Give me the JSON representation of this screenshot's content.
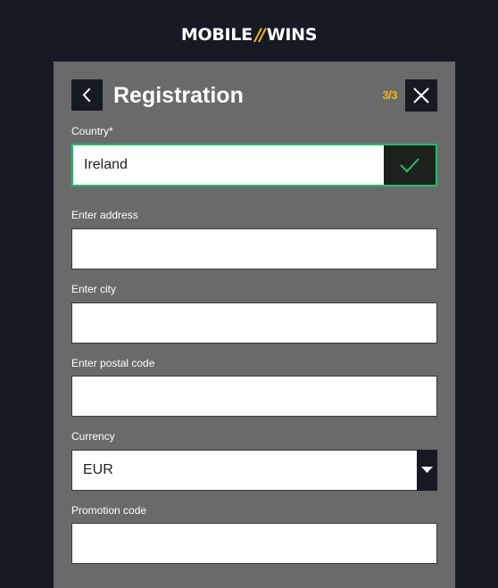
{
  "logo": {
    "left": "MOBILE",
    "slash": "//",
    "right": "WINS",
    "brand_accent_color": "#f5b800"
  },
  "header": {
    "title": "Registration",
    "step": "3/3",
    "back_icon": "chevron-left-icon",
    "close_icon": "close-icon"
  },
  "form": {
    "country": {
      "label": "Country*",
      "value": "Ireland",
      "status": "valid",
      "status_icon": "checkmark-icon",
      "valid_color": "#1fbf6a"
    },
    "address": {
      "label": "Enter address",
      "value": ""
    },
    "city": {
      "label": "Enter city",
      "value": ""
    },
    "postal_code": {
      "label": "Enter postal code",
      "value": ""
    },
    "currency": {
      "label": "Currency",
      "value": "EUR",
      "arrow_icon": "caret-down-icon"
    },
    "promotion_code": {
      "label": "Promotion code",
      "value": ""
    }
  },
  "colors": {
    "page_background": "#161a25",
    "panel_background": "#6a6a6a"
  }
}
